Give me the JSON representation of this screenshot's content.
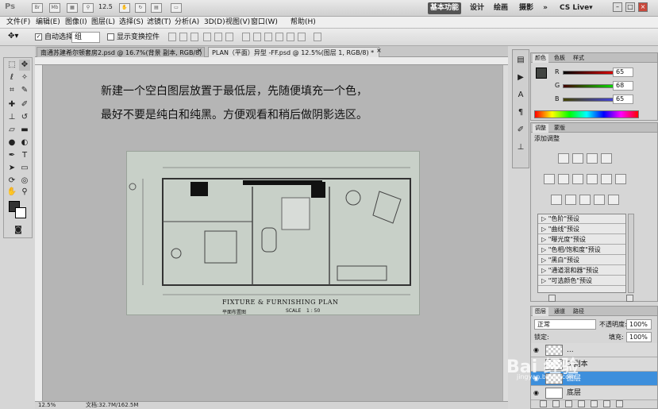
{
  "app": {
    "logo": "Ps",
    "zoom_select": "12.5",
    "workspaces": [
      "基本功能",
      "设计",
      "绘画",
      "摄影"
    ],
    "workspace_more": "»",
    "cs_live": "CS Live▾"
  },
  "menu": [
    "文件(F)",
    "编辑(E)",
    "图像(I)",
    "图层(L)",
    "选择(S)",
    "滤镜(T)",
    "分析(A)",
    "3D(D)",
    "视图(V)",
    "窗口(W)",
    "帮助(H)"
  ],
  "options": {
    "auto_select_label": "自动选择:",
    "auto_select_value": "组",
    "transform_label": "显示变换控件"
  },
  "tabs": [
    {
      "label": "南通苏建希尔顿套房2.psd @ 16.7%(背景 副本, RGB/8) *",
      "close": "×"
    },
    {
      "label": "PLAN（平面）异型 -FF.psd @ 12.5%(图层 1, RGB/8) *",
      "close": "×"
    }
  ],
  "canvas": {
    "instruction_line1": "新建一个空白图层放置于最低层，先随便填充一个色，",
    "instruction_line2": "最好不要是纯白和纯黑。方便观看和稍后做阴影选区。",
    "plan_title": "FIXTURE  &  FURNISHING  PLAN",
    "plan_subtitle": "平面布置图",
    "plan_scale_label": "SCALE",
    "plan_scale_value": "1 : 50"
  },
  "status": {
    "zoom": "12.5%",
    "doc": "文档:32.7M/162.5M"
  },
  "color_panel": {
    "tabs": [
      "颜色",
      "色板",
      "样式"
    ],
    "r_label": "R",
    "r_value": "65",
    "g_label": "G",
    "g_value": "68",
    "b_label": "B",
    "b_value": "65"
  },
  "adjust_panel": {
    "tabs": [
      "调整",
      "蒙版"
    ],
    "title": "添加调整",
    "presets": [
      "\"色阶\"预设",
      "\"曲线\"预设",
      "\"曝光度\"预设",
      "\"色相/饱和度\"预设",
      "\"黑白\"预设",
      "\"通道混和器\"预设",
      "\"可选颜色\"预设"
    ]
  },
  "layers_panel": {
    "tabs": [
      "图层",
      "通道",
      "路径"
    ],
    "blend_mode": "正常",
    "opacity_label": "不透明度:",
    "opacity_value": "100%",
    "lock_label": "锁定:",
    "fill_label": "填充:",
    "fill_value": "100%",
    "layers": [
      {
        "name": "...",
        "visible": true,
        "selected": false
      },
      {
        "name": "3 副本",
        "visible": false,
        "selected": false
      },
      {
        "name": "图层",
        "visible": true,
        "selected": true
      },
      {
        "name": "底层",
        "visible": true,
        "selected": false
      }
    ]
  },
  "watermark": {
    "text": "Bai 经验",
    "url": "jingyan.baidu.com"
  },
  "colors": {
    "accent": "#3d8fdc",
    "foreground": "#414441",
    "background_swatch": "#ffffff",
    "canvas": "#b5b5b5",
    "drawing_bg": "#c8d0c8"
  }
}
